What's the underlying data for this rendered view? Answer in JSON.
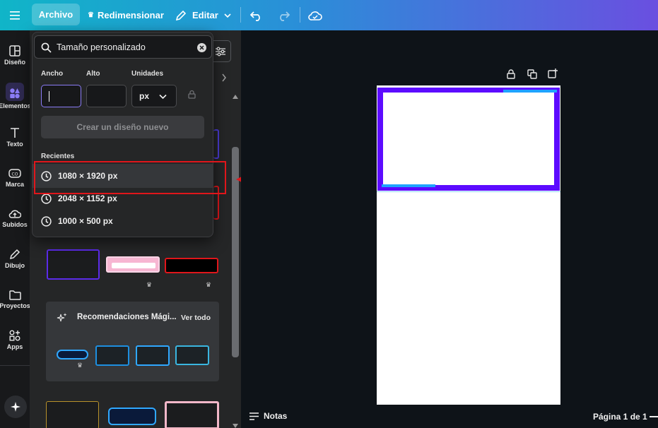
{
  "topbar": {
    "file_label": "Archivo",
    "resize_label": "Redimensionar",
    "edit_label": "Editar"
  },
  "rail": {
    "items": [
      {
        "label": "Diseño",
        "icon": "layout-icon"
      },
      {
        "label": "Elementos",
        "icon": "shapes-icon"
      },
      {
        "label": "Texto",
        "icon": "text-icon"
      },
      {
        "label": "Marca",
        "icon": "brand-icon"
      },
      {
        "label": "Subidos",
        "icon": "cloud-upload-icon"
      },
      {
        "label": "Dibujo",
        "icon": "pen-icon"
      },
      {
        "label": "Proyectos",
        "icon": "folder-icon"
      },
      {
        "label": "Apps",
        "icon": "apps-icon"
      }
    ]
  },
  "dropdown": {
    "search_value": "Tamaño personalizado",
    "width_label": "Ancho",
    "height_label": "Alto",
    "units_label": "Unidades",
    "units_value": "px",
    "width_value": "",
    "height_value": "",
    "create_label": "Crear un diseño nuevo",
    "recent_label": "Recientes",
    "recents": [
      "1080 × 1920 px",
      "2048 × 1152 px",
      "1000 × 500 px"
    ]
  },
  "panel": {
    "reco_title": "Recomendaciones Mági...",
    "see_all": "Ver todo"
  },
  "status": {
    "notes": "Notas",
    "page": "Página 1 de 1"
  },
  "colors": {
    "accent": "#8b7cf6",
    "frame": "#5c0bff",
    "annotation": "#e0161b"
  }
}
